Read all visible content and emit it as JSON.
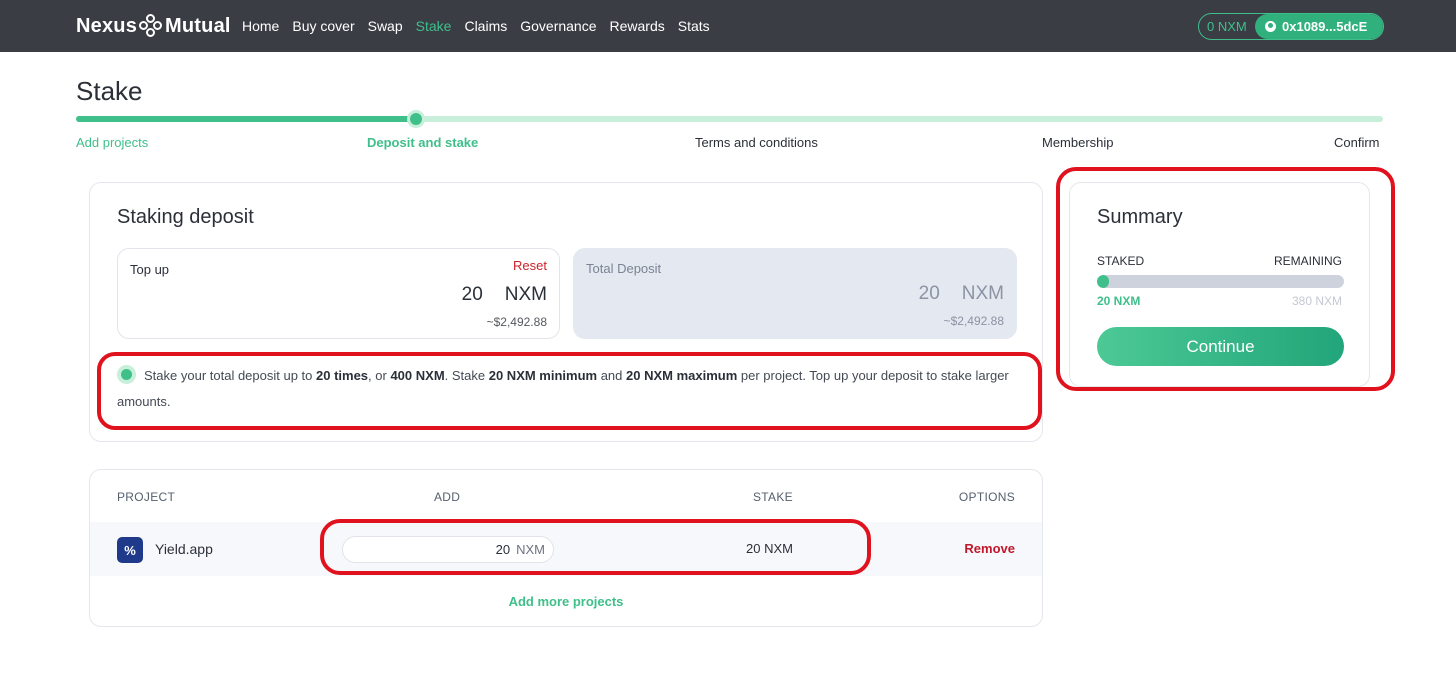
{
  "brand": {
    "name_left": "Nexus",
    "name_right": "Mutual"
  },
  "nav": [
    {
      "label": "Home",
      "active": false
    },
    {
      "label": "Buy cover",
      "active": false
    },
    {
      "label": "Swap",
      "active": false
    },
    {
      "label": "Stake",
      "active": true
    },
    {
      "label": "Claims",
      "active": false
    },
    {
      "label": "Governance",
      "active": false
    },
    {
      "label": "Rewards",
      "active": false
    },
    {
      "label": "Stats",
      "active": false
    }
  ],
  "wallet": {
    "balance": "0 NXM",
    "address": "0x1089...5dcE"
  },
  "page": {
    "title": "Stake"
  },
  "stepper": {
    "progress_fraction": 0.26,
    "steps": [
      "Add projects",
      "Deposit and stake",
      "Terms and conditions",
      "Membership",
      "Confirm"
    ],
    "current_index": 1
  },
  "deposit": {
    "heading": "Staking deposit",
    "topup": {
      "label": "Top up",
      "reset_label": "Reset",
      "amount": "20",
      "unit": "NXM",
      "usd": "~$2,492.88"
    },
    "total": {
      "label": "Total Deposit",
      "amount": "20",
      "unit": "NXM",
      "usd": "~$2,492.88"
    },
    "info": {
      "t1": "Stake your total deposit up to ",
      "b1": "20 times",
      "t2": ", or ",
      "b2": "400 NXM",
      "t3": ". Stake ",
      "b3": "20 NXM minimum",
      "t4": " and ",
      "b4": "20 NXM maximum",
      "t5": " per project. Top up your deposit to stake larger amounts."
    }
  },
  "summary": {
    "heading": "Summary",
    "staked_label": "STAKED",
    "remaining_label": "REMAINING",
    "staked_value": "20 NXM",
    "remaining_value": "380 NXM",
    "staked_fraction": 0.05,
    "continue_label": "Continue"
  },
  "table": {
    "headers": {
      "project": "PROJECT",
      "add": "ADD",
      "stake": "STAKE",
      "options": "OPTIONS"
    },
    "rows": [
      {
        "icon": "%",
        "project": "Yield.app",
        "add_value": "20",
        "add_unit": "NXM",
        "stake": "20 NXM",
        "remove_label": "Remove"
      }
    ],
    "add_more_label": "Add more projects"
  },
  "colors": {
    "accent": "#3fbf8a",
    "danger": "#d0222c",
    "nav_bg": "#3a3d44",
    "highlight": "#e0121e"
  }
}
